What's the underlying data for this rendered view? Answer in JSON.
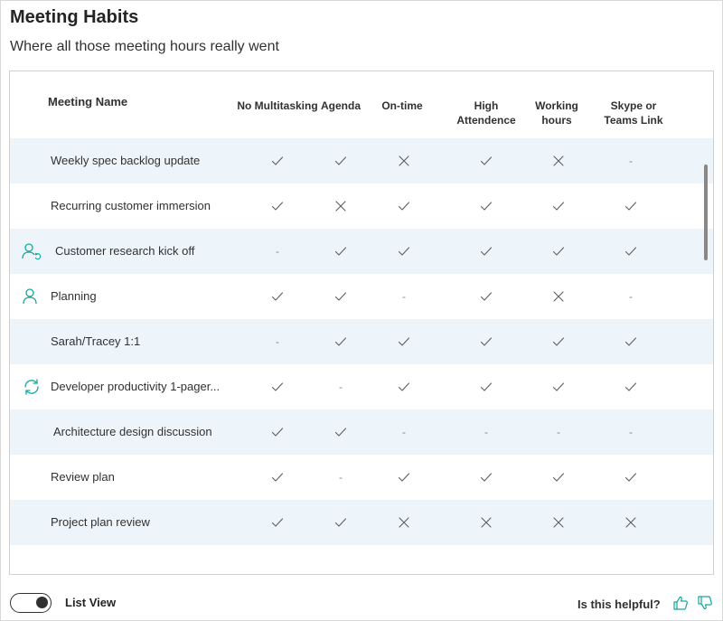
{
  "header": {
    "title": "Meeting Habits",
    "subtitle": "Where all those meeting hours really went"
  },
  "columns": {
    "name": "Meeting Name",
    "metrics": [
      [
        "No Multitasking"
      ],
      [
        "Agenda"
      ],
      [
        "On-time"
      ],
      [
        "High",
        "Attendence"
      ],
      [
        "Working",
        "hours"
      ],
      [
        "Skype or",
        "Teams Link"
      ]
    ]
  },
  "legend_symbols": {
    "dash": "-"
  },
  "meetings": [
    {
      "name": "Weekly spec backlog update",
      "icon": "none",
      "values": [
        "check",
        "check",
        "x",
        "check",
        "x",
        "dash"
      ]
    },
    {
      "name": "Recurring customer immersion",
      "icon": "none",
      "values": [
        "check",
        "x",
        "check",
        "check",
        "check",
        "check"
      ]
    },
    {
      "name": "Customer research kick off",
      "icon": "person-recurring-icon",
      "values": [
        "dash",
        "check",
        "check",
        "check",
        "check",
        "check"
      ]
    },
    {
      "name": "Planning",
      "icon": "person-icon",
      "values": [
        "check",
        "check",
        "dash",
        "check",
        "x",
        "dash"
      ]
    },
    {
      "name": "Sarah/Tracey 1:1",
      "icon": "none",
      "values": [
        "dash",
        "check",
        "check",
        "check",
        "check",
        "check"
      ]
    },
    {
      "name": "Developer productivity 1-pager...",
      "icon": "recurring-icon",
      "values": [
        "check",
        "dash",
        "check",
        "check",
        "check",
        "check"
      ]
    },
    {
      "name": "Architecture design discussion",
      "icon": "none",
      "values": [
        "check",
        "check",
        "dash",
        "dash",
        "dash",
        "dash"
      ]
    },
    {
      "name": "Review plan",
      "icon": "none",
      "values": [
        "check",
        "dash",
        "check",
        "check",
        "check",
        "check"
      ]
    },
    {
      "name": "Project plan review",
      "icon": "none",
      "values": [
        "check",
        "check",
        "x",
        "x",
        "x",
        "x"
      ]
    }
  ],
  "footer": {
    "list_view_label": "List View",
    "list_view_on": true,
    "helpful_text": "Is this helpful?"
  },
  "colors": {
    "accent": "#13a89e",
    "row_alt": "#eef5fa",
    "mark": "#605e5c"
  }
}
